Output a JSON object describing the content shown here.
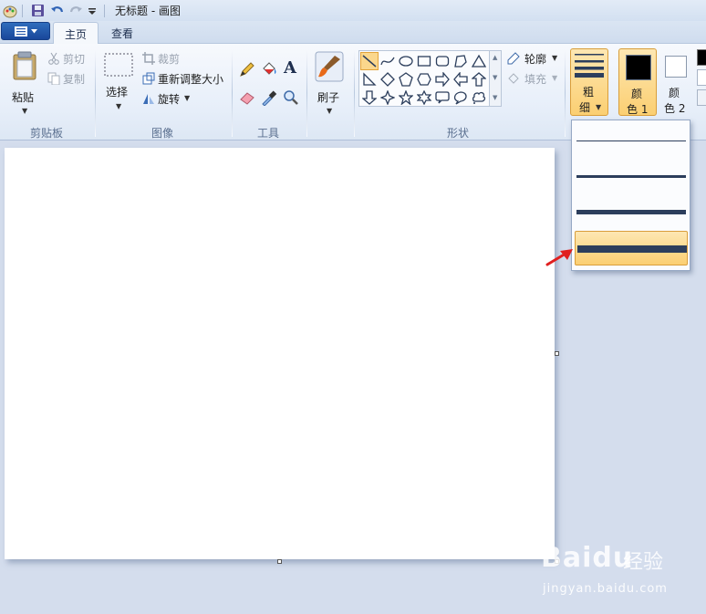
{
  "window": {
    "title": "无标题 - 画图"
  },
  "tabs": [
    {
      "label": "主页",
      "active": true
    },
    {
      "label": "查看",
      "active": false
    }
  ],
  "clipboard": {
    "paste": "粘贴",
    "cut": "剪切",
    "copy": "复制",
    "group": "剪贴板"
  },
  "image": {
    "select": "选择",
    "crop": "裁剪",
    "resize": "重新调整大小",
    "rotate": "旋转",
    "group": "图像"
  },
  "tools": {
    "group": "工具"
  },
  "brush": {
    "label": "刷子"
  },
  "shapes": {
    "outline": "轮廓",
    "fill": "填充",
    "group": "形状"
  },
  "size": {
    "label_line1": "粗",
    "label_line2": "细"
  },
  "colors": {
    "color1_line1": "颜",
    "color1_line2": "色 1",
    "color2_line1": "颜",
    "color2_line2": "色 2",
    "color1_value": "#000000",
    "color2_value": "#ffffff",
    "accent": "#fbcf72",
    "line": "#2c3e5c"
  },
  "size_dropdown": {
    "options": [
      {
        "weight": 1,
        "selected": false
      },
      {
        "weight": 3,
        "selected": false
      },
      {
        "weight": 5,
        "selected": false
      },
      {
        "weight": 8,
        "selected": true
      }
    ]
  },
  "watermark": {
    "brand": "Baidu",
    "cn": "经验",
    "url": "jingyan.baidu.com"
  }
}
